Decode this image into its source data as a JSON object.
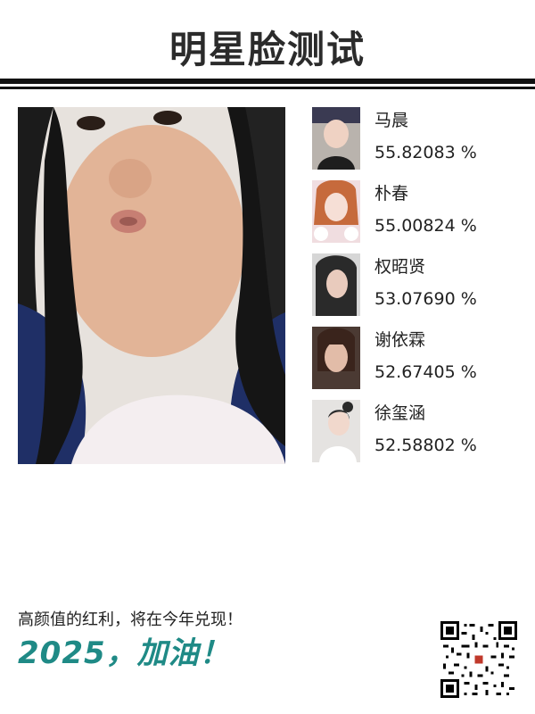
{
  "header": {
    "title": "明星脸测试"
  },
  "results": [
    {
      "name": "马晨",
      "score": "55.82083 %"
    },
    {
      "name": "朴春",
      "score": "55.00824 %"
    },
    {
      "name": "权昭贤",
      "score": "53.07690 %"
    },
    {
      "name": "谢依霖",
      "score": "52.67405 %"
    },
    {
      "name": "徐玺涵",
      "score": "52.58802 %"
    }
  ],
  "footer": {
    "slogan": "高颜值的红利，将在今年兑现！",
    "cta": "2025，加油！"
  },
  "colors": {
    "accent": "#1f8a86",
    "rule": "#111111",
    "text": "#222222"
  }
}
